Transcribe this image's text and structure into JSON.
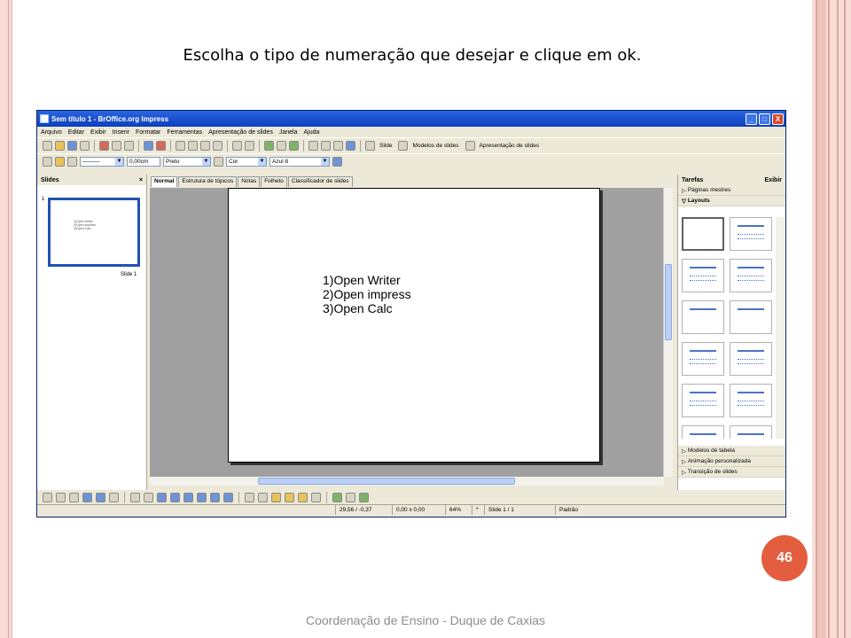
{
  "slide": {
    "heading": "Escolha o tipo de numeração que desejar e clique em ok.",
    "footer": "Coordenação de Ensino - Duque de Caxias",
    "page_number": "46"
  },
  "window": {
    "title": "Sem título 1 - BrOffice.org Impress",
    "minimize": "_",
    "maximize": "□",
    "close": "X"
  },
  "menu": [
    "Arquivo",
    "Editar",
    "Exibir",
    "Inserir",
    "Formatar",
    "Ferramentas",
    "Apresentação de slides",
    "Janela",
    "Ajuda"
  ],
  "toolbar": {
    "slide_label": "Slide",
    "models_label": "Modelos de slides",
    "presentation_label": "Apresentação de slides"
  },
  "format_bar": {
    "line_width": "0,00cm",
    "line_color": "Preto",
    "fill_type": "Cor",
    "fill_color": "Azul 8"
  },
  "slides_pane": {
    "title": "Slides",
    "close": "×",
    "index": "1",
    "caption": "Slide 1",
    "thumb_lines": [
      "1)Open Writer",
      "2)Open impress",
      "3)Open Calc"
    ]
  },
  "tabs": [
    "Normal",
    "Estrutura de tópicos",
    "Notas",
    "Folheto",
    "Classificador de slides"
  ],
  "content": {
    "items": [
      "1)Open Writer",
      "2)Open impress",
      "3)Open Calc"
    ]
  },
  "tasks_pane": {
    "title": "Tarefas",
    "view": "Exibir",
    "sections_top": [
      "Páginas mestres",
      "Layouts"
    ],
    "sections_bottom": [
      "Modelos de tabela",
      "Animação personalizada",
      "Transição de slides"
    ]
  },
  "status": {
    "position": "29,56 / -0,37",
    "size": "0,00 x 0,00",
    "zoom": "64%",
    "modified": "*",
    "slide": "Slide 1 / 1",
    "layout": "Padrão"
  }
}
